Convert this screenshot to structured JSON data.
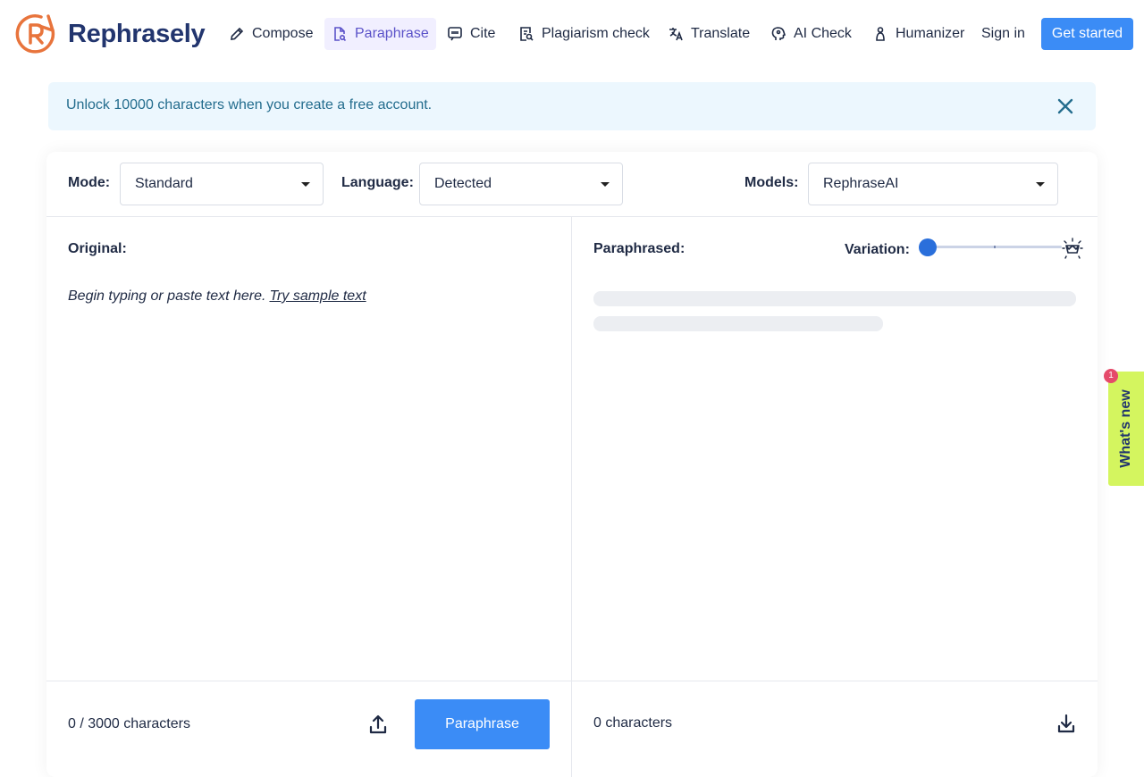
{
  "brand": {
    "name": "Rephrasely",
    "accent": "#3b8cf6",
    "logo_color": "#e8743c"
  },
  "nav": [
    {
      "label": "Compose",
      "icon": "pencil-icon",
      "active": false
    },
    {
      "label": "Paraphrase",
      "icon": "document-search-icon",
      "active": true
    },
    {
      "label": "Cite",
      "icon": "quote-icon",
      "active": false
    },
    {
      "label": "Plagiarism check",
      "icon": "document-magnifier-icon",
      "active": false
    },
    {
      "label": "Translate",
      "icon": "translate-icon",
      "active": false
    },
    {
      "label": "AI Check",
      "icon": "brain-icon",
      "active": false
    },
    {
      "label": "Humanizer",
      "icon": "person-icon",
      "active": false
    }
  ],
  "auth": {
    "signin": "Sign in",
    "get_started": "Get started"
  },
  "banner": {
    "text": "Unlock 10000 characters when you create a free account."
  },
  "toolbar": {
    "mode_label": "Mode:",
    "mode_value": "Standard",
    "language_label": "Language:",
    "language_value": "Detected",
    "models_label": "Models:",
    "models_value": "RephraseAI"
  },
  "original": {
    "title": "Original:",
    "placeholder": "Begin typing or paste text here.",
    "sample_link": "Try sample text",
    "count": "0 / 3000 characters",
    "action": "Paraphrase"
  },
  "paraphrased": {
    "title": "Paraphrased:",
    "variation_label": "Variation:",
    "variation_value": 0,
    "count": "0 characters"
  },
  "whats_new": {
    "label": "What's new",
    "badge": "1"
  }
}
